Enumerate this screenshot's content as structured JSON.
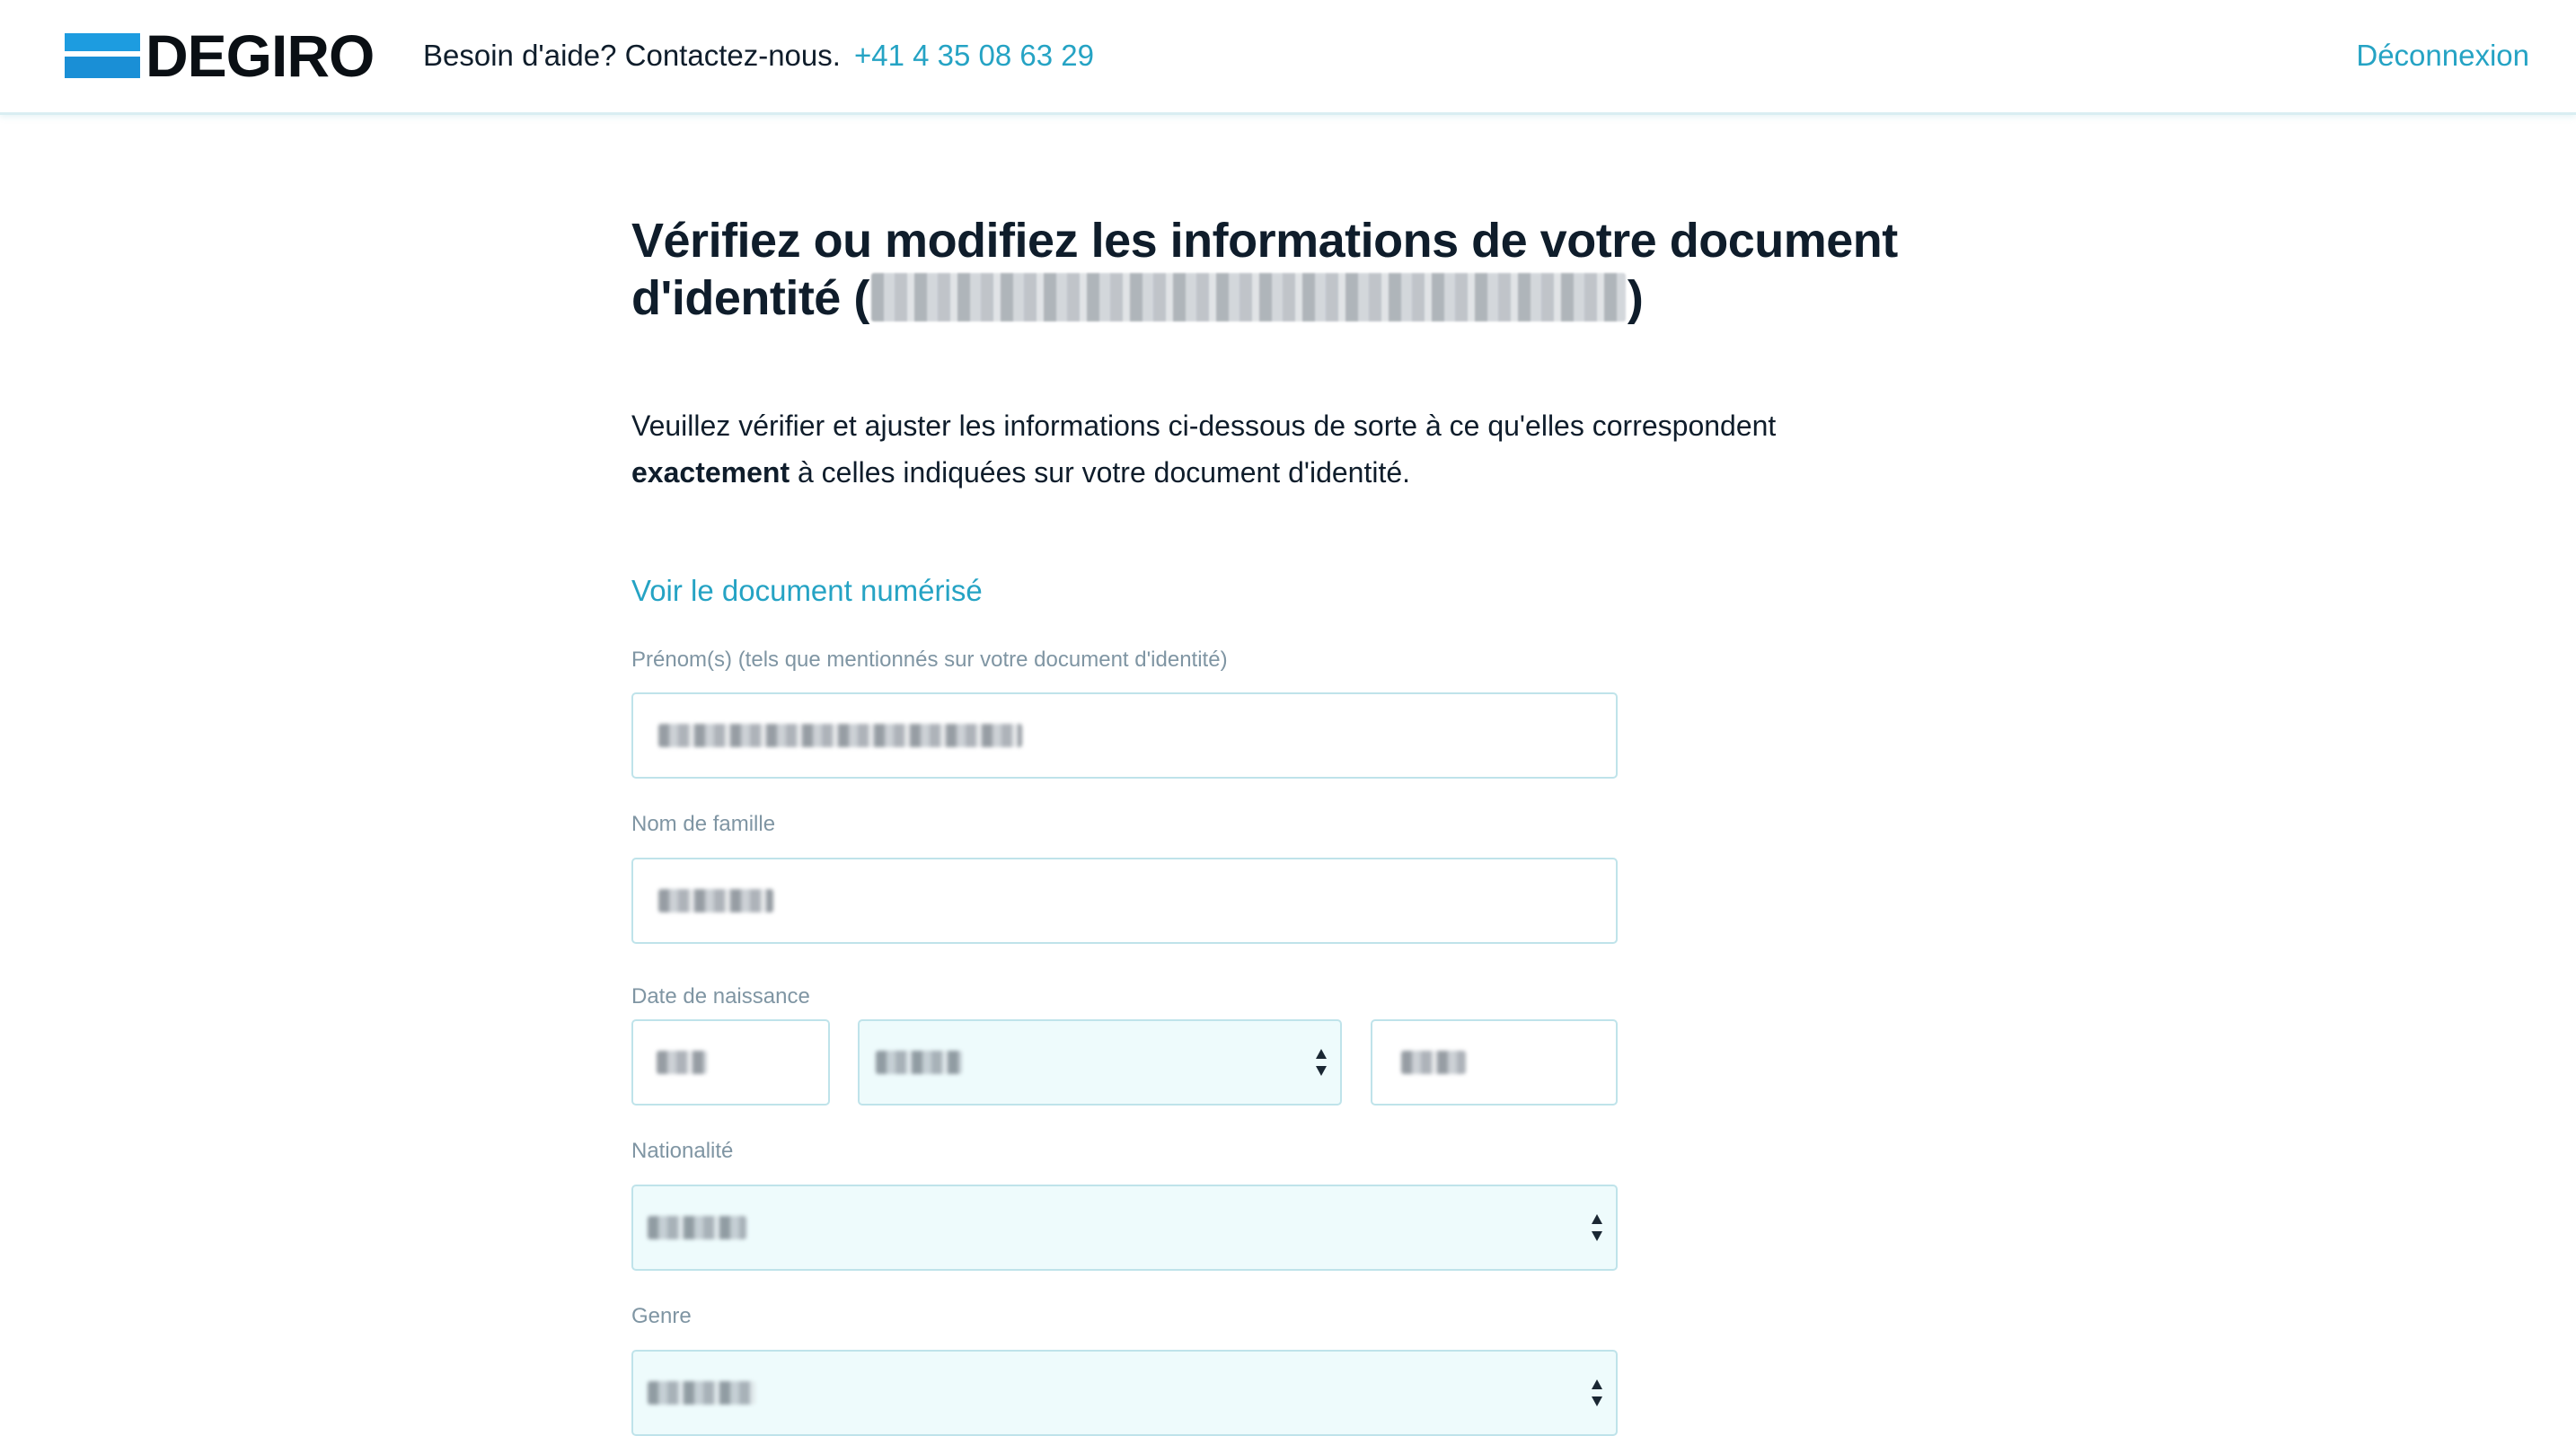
{
  "header": {
    "logo_text": "DEGIRO",
    "help_text": "Besoin d'aide? Contactez-nous.",
    "phone": "+41 4 35 08 63 29",
    "logout_label": "Déconnexion"
  },
  "main": {
    "title_prefix": "Vérifiez ou modifiez les informations de votre document d'identité (",
    "title_suffix": ")",
    "intro_part1": "Veuillez vérifier et ajuster les informations ci-dessous de sorte à ce qu'elles correspondent ",
    "intro_bold": "exactement",
    "intro_part2": " à celles indiquées sur votre document d'identité.",
    "view_document_link": "Voir le document numérisé"
  },
  "form": {
    "first_name_label": "Prénom(s) (tels que mentionnés sur votre document d'identité)",
    "last_name_label": "Nom de famille",
    "birth_date_label": "Date de naissance",
    "nationality_label": "Nationalité",
    "gender_label": "Genre"
  },
  "icons": {
    "select_arrows": "updown-chevron-icon",
    "logo_mark": "degiro-bars-icon"
  },
  "colors": {
    "accent": "#25a3c4",
    "brand_blue": "#1d9ce0",
    "select_bg": "#eefbfc",
    "input_border": "#bfe3ea",
    "label_gray": "#7f95a3"
  }
}
